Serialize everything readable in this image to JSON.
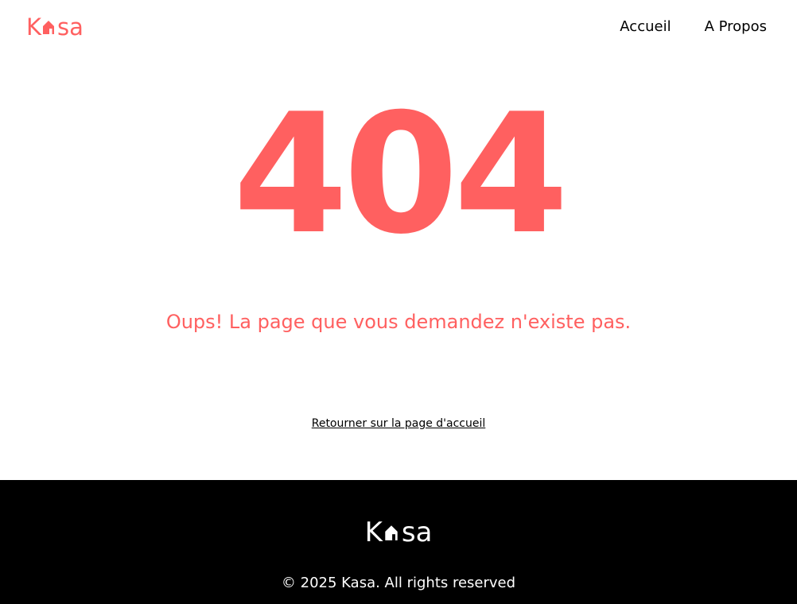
{
  "header": {
    "logo": {
      "letter_first": "K",
      "letters_rest": "sa",
      "icon": "house-icon",
      "color": "#FF6060"
    },
    "nav": {
      "home_label": "Accueil",
      "about_label": "A Propos"
    }
  },
  "main": {
    "error_code": "404",
    "error_message": "Oups! La page que vous demandez n'existe pas.",
    "home_link_label": "Retourner sur la page d'accueil",
    "accent_color": "#FF6060"
  },
  "footer": {
    "logo": {
      "letter_first": "K",
      "letters_rest": "sa",
      "icon": "house-icon",
      "color": "#FFFFFF"
    },
    "copyright": "© 2025 Kasa. All rights reserved",
    "background": "#000000"
  }
}
